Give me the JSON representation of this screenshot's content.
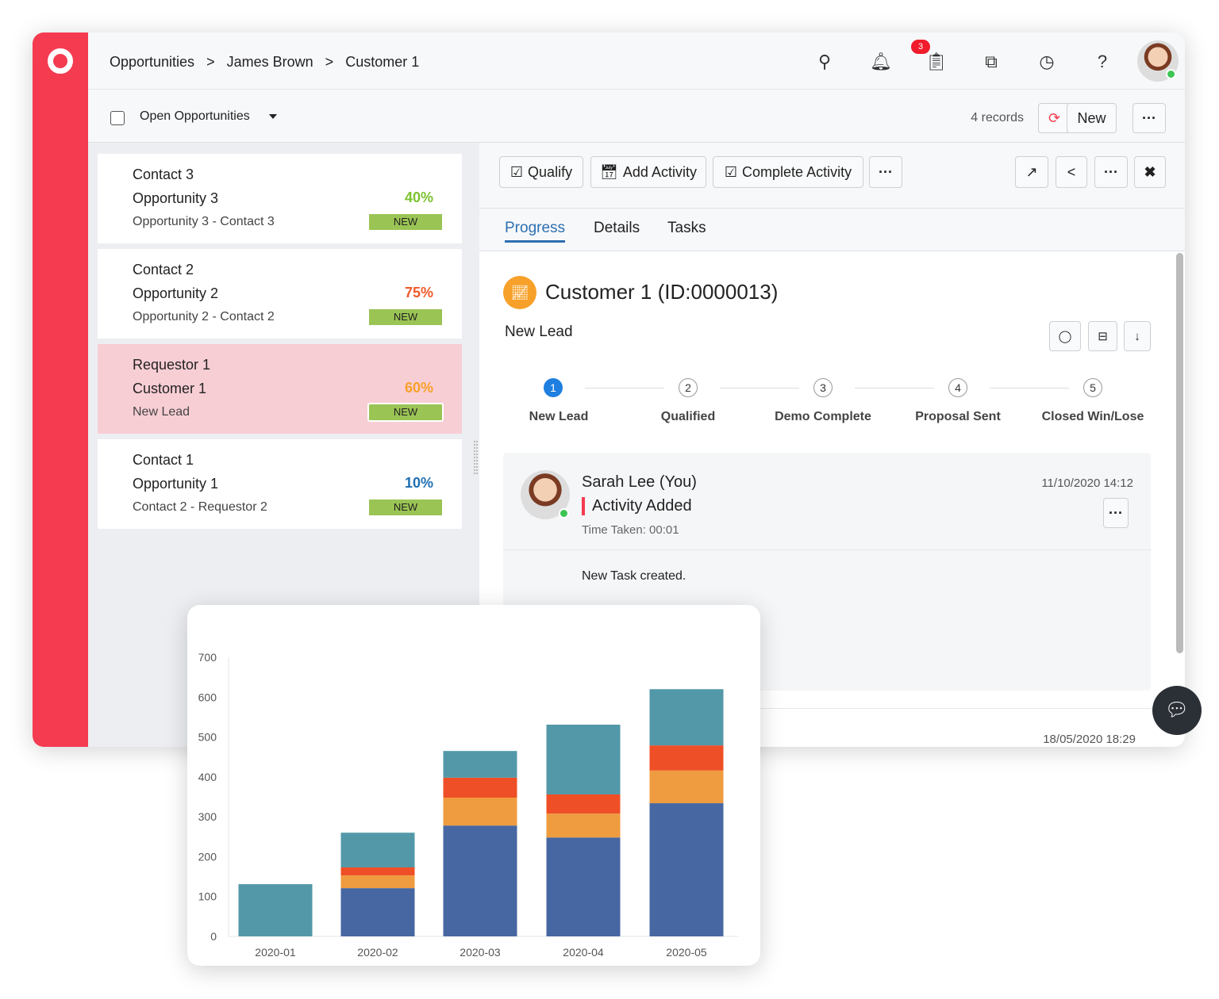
{
  "breadcrumb": [
    "Opportunities",
    ">",
    "James Brown",
    ">",
    "Customer 1"
  ],
  "header_icons": [
    "search-icon",
    "bell-icon",
    "clipboard-icon",
    "rss-icon",
    "clock-icon",
    "help-icon"
  ],
  "notification_count": "3",
  "view": {
    "label": "Open Opportunities",
    "records": "4 records",
    "new_label": "New"
  },
  "list": [
    {
      "line1": "Contact 3",
      "line2": "Opportunity 3",
      "line3": "Opportunity 3 - Contact 3",
      "pct": "40%",
      "pct_color": "#7cc22e",
      "badge": "NEW",
      "selected": false
    },
    {
      "line1": "Contact 2",
      "line2": "Opportunity 2",
      "line3": "Opportunity 2 - Contact 2",
      "pct": "75%",
      "pct_color": "#f0592a",
      "badge": "NEW",
      "selected": false
    },
    {
      "line1": "Requestor 1",
      "line2": "Customer 1",
      "line3": "New Lead",
      "pct": "60%",
      "pct_color": "#f7a12a",
      "badge": "NEW",
      "selected": true
    },
    {
      "line1": "Contact 1",
      "line2": "Opportunity 1",
      "line3": "Contact 2 - Requestor 2",
      "pct": "10%",
      "pct_color": "#1f6fb2",
      "badge": "NEW",
      "selected": false
    }
  ],
  "actions": {
    "qualify": "Qualify",
    "add_activity": "Add Activity",
    "complete_activity": "Complete Activity"
  },
  "tabs": [
    "Progress",
    "Details",
    "Tasks"
  ],
  "record": {
    "title": "Customer 1 (ID:0000013)",
    "stage": "New Lead"
  },
  "steps": [
    {
      "n": "1",
      "label": "New Lead"
    },
    {
      "n": "2",
      "label": "Qualified"
    },
    {
      "n": "3",
      "label": "Demo Complete"
    },
    {
      "n": "4",
      "label": "Proposal Sent"
    },
    {
      "n": "5",
      "label": "Closed Win/Lose"
    }
  ],
  "activity": {
    "user": "Sarah Lee (You)",
    "title": "Activity Added",
    "time_taken": "Time Taken: 00:01",
    "date": "11/10/2020 14:12",
    "body": "New Task created.",
    "next_date": "18/05/2020 18:29"
  },
  "chart_data": {
    "type": "bar",
    "stacked": true,
    "categories": [
      "2020-01",
      "2020-02",
      "2020-03",
      "2020-04",
      "2020-05"
    ],
    "series": [
      {
        "color": "#4767a2",
        "values": [
          0,
          121,
          278,
          248,
          334
        ]
      },
      {
        "color": "#ef9b3f",
        "values": [
          0,
          32,
          70,
          60,
          82
        ]
      },
      {
        "color": "#ef4f26",
        "values": [
          0,
          20,
          50,
          48,
          63
        ]
      },
      {
        "color": "#5398a8",
        "values": [
          131,
          87,
          67,
          175,
          141
        ]
      }
    ],
    "yticks": [
      0,
      100,
      200,
      300,
      400,
      500,
      600,
      700
    ],
    "ylim": [
      0,
      700
    ],
    "grid": false
  }
}
